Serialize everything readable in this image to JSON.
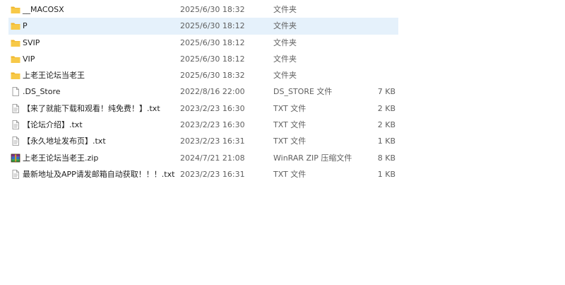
{
  "files": [
    {
      "name": "__MACOSX",
      "date": "2025/6/30 18:32",
      "type": "文件夹",
      "size": "",
      "icon": "folder-icon",
      "selected": false
    },
    {
      "name": "P",
      "date": "2025/6/30 18:12",
      "type": "文件夹",
      "size": "",
      "icon": "folder-icon",
      "selected": true
    },
    {
      "name": "SVIP",
      "date": "2025/6/30 18:12",
      "type": "文件夹",
      "size": "",
      "icon": "folder-icon",
      "selected": false
    },
    {
      "name": "VIP",
      "date": "2025/6/30 18:12",
      "type": "文件夹",
      "size": "",
      "icon": "folder-icon",
      "selected": false
    },
    {
      "name": "上老王论坛当老王",
      "date": "2025/6/30 18:32",
      "type": "文件夹",
      "size": "",
      "icon": "folder-icon",
      "selected": false
    },
    {
      "name": ".DS_Store",
      "date": "2022/8/16 22:00",
      "type": "DS_STORE 文件",
      "size": "7 KB",
      "icon": "file-icon",
      "selected": false
    },
    {
      "name": "【来了就能下载和观看！纯免费！】.txt",
      "date": "2023/2/23 16:30",
      "type": "TXT 文件",
      "size": "2 KB",
      "icon": "text-file-icon",
      "selected": false
    },
    {
      "name": "【论坛介绍】.txt",
      "date": "2023/2/23 16:30",
      "type": "TXT 文件",
      "size": "2 KB",
      "icon": "text-file-icon",
      "selected": false
    },
    {
      "name": "【永久地址发布页】.txt",
      "date": "2023/2/23 16:31",
      "type": "TXT 文件",
      "size": "1 KB",
      "icon": "text-file-icon",
      "selected": false
    },
    {
      "name": "上老王论坛当老王.zip",
      "date": "2024/7/21 21:08",
      "type": "WinRAR ZIP 压缩文件",
      "size": "8 KB",
      "icon": "winrar-archive-icon",
      "selected": false
    },
    {
      "name": "最新地址及APP请发邮箱自动获取！！！.txt",
      "date": "2023/2/23 16:31",
      "type": "TXT 文件",
      "size": "1 KB",
      "icon": "text-file-icon",
      "selected": false
    }
  ],
  "colors": {
    "selection": "#e5f1fb",
    "folder": "#f4c142",
    "secondary_text": "#5f5f5f"
  }
}
